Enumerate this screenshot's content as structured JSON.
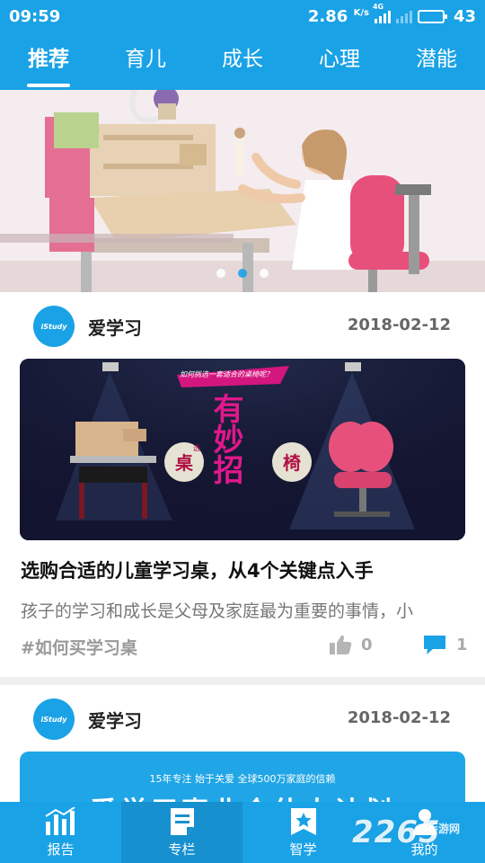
{
  "status_bar": {
    "time": "09:59",
    "speed_value": "2.86",
    "speed_unit": "K/s",
    "network_label": "4G",
    "battery": "43",
    "battery_level": 0.43
  },
  "tabs": [
    {
      "label": "推荐",
      "active": true
    },
    {
      "label": "育儿",
      "active": false
    },
    {
      "label": "成长",
      "active": false
    },
    {
      "label": "心理",
      "active": false
    },
    {
      "label": "潜能",
      "active": false
    }
  ],
  "banner": {
    "dot_count": 3,
    "active_dot": 1
  },
  "articles": [
    {
      "author": "爱学习",
      "avatar_text": "iStudy",
      "date": "2018-02-12",
      "cover_heading": "有妙招",
      "cover_left_tag": "桌",
      "cover_right_tag": "椅",
      "cover_small_label": "选",
      "cover_caption": "如何挑选一套适合的桌椅呢？",
      "title": "选购合适的儿童学习桌，从4个关键点入手",
      "description": "孩子的学习和成长是父母及家庭最为重要的事情，小",
      "tag": "#如何买学习桌",
      "likes": "0",
      "comments": "1"
    },
    {
      "author": "爱学习",
      "avatar_text": "iStudy",
      "date": "2018-02-12",
      "cover_slogan": "15年专注 始于关爱 全球500万家庭的信赖",
      "cover_heading": "爱学习事业合伙人计划"
    }
  ],
  "bottom_nav": [
    {
      "label": "报告",
      "icon": "bar-chart-icon",
      "active": false
    },
    {
      "label": "专栏",
      "icon": "document-icon",
      "active": true
    },
    {
      "label": "智学",
      "icon": "star-bookmark-icon",
      "active": false
    },
    {
      "label": "我的",
      "icon": "person-icon",
      "active": false
    }
  ],
  "watermark": {
    "brand": "2265",
    "subtitle": "手游网"
  },
  "colors": {
    "primary": "#1aa2e6",
    "nav_active": "#1790cf",
    "magenta": "#e0188c",
    "pink_furniture": "#e8507c"
  }
}
